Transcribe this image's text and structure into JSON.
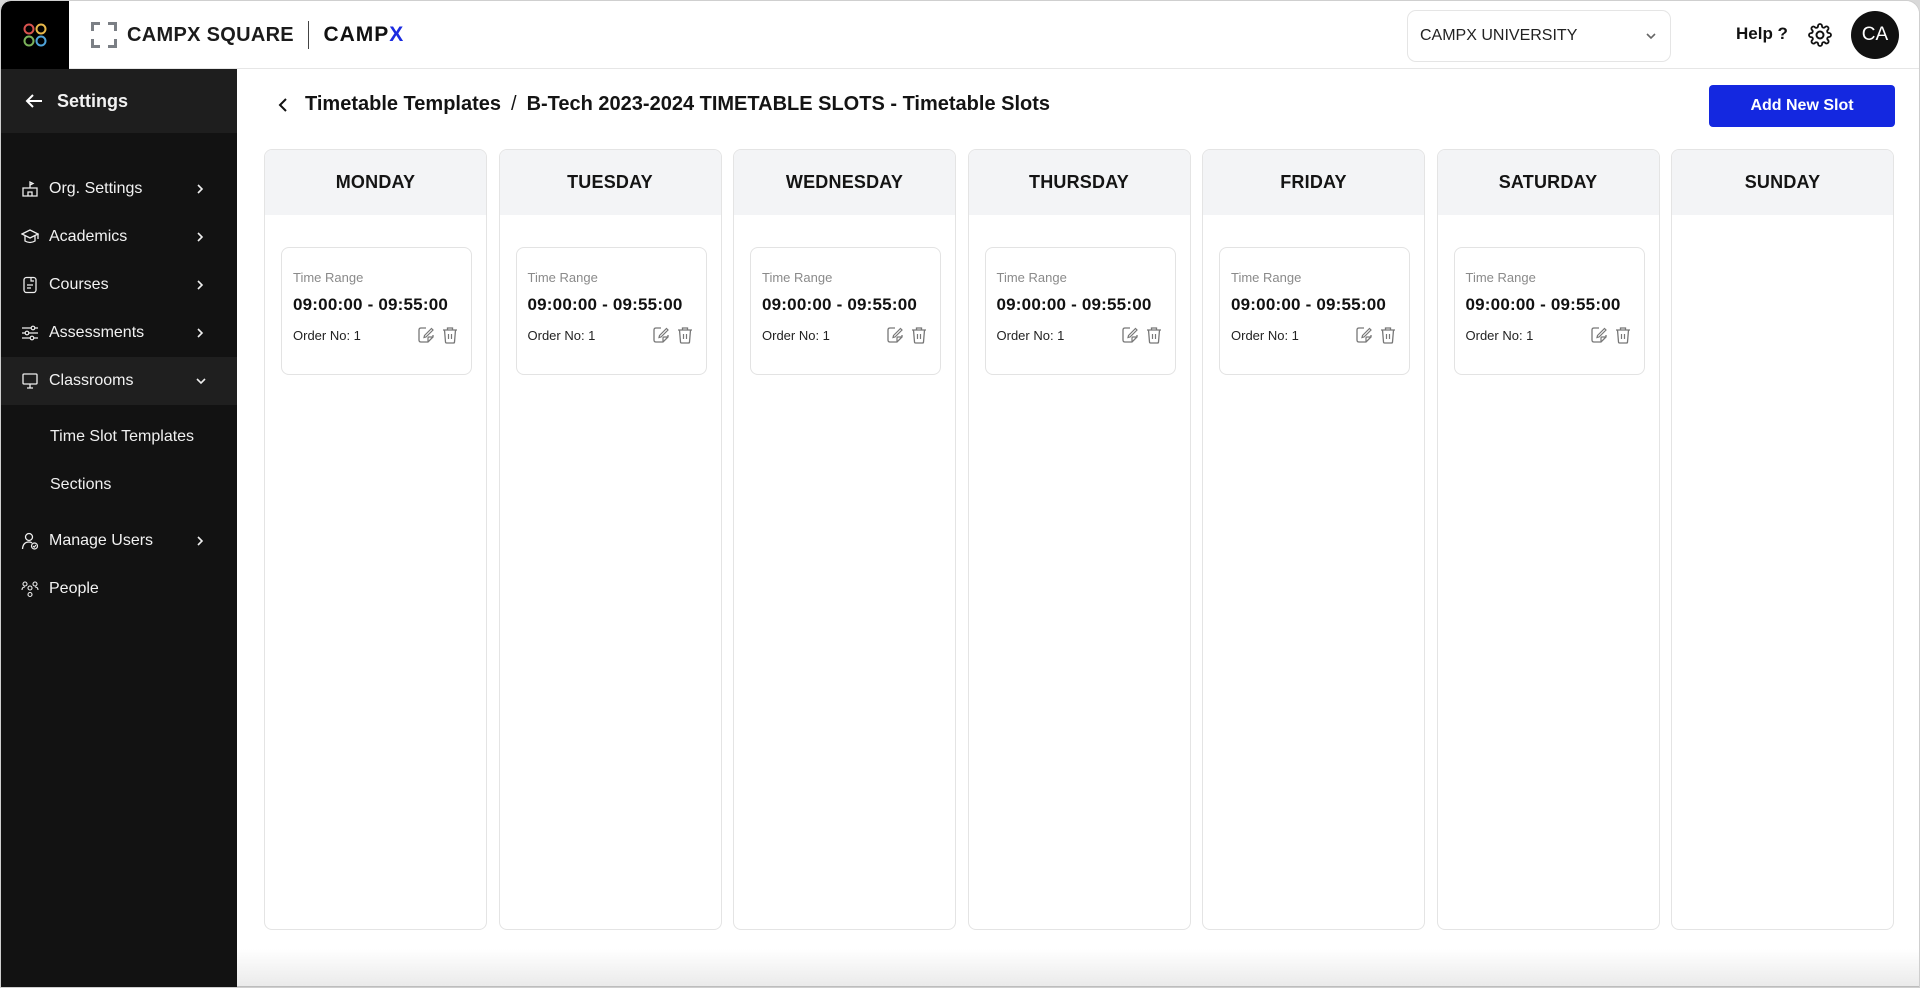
{
  "header": {
    "apps_icon": "apps-grid-icon",
    "brand_name": "CAMPX SQUARE",
    "brand_secondary_prefix": "CAMP",
    "brand_secondary_x": "X",
    "institution_select": {
      "value": "CAMPX UNIVERSITY"
    },
    "help_label": "Help ?",
    "settings_icon": "gear-icon",
    "avatar_initials": "CA"
  },
  "sidebar": {
    "back_title": "Settings",
    "items": [
      {
        "label": "Org. Settings",
        "icon": "building-icon",
        "expanded": false
      },
      {
        "label": "Academics",
        "icon": "graduation-cap-icon",
        "expanded": false
      },
      {
        "label": "Courses",
        "icon": "document-icon",
        "expanded": false
      },
      {
        "label": "Assessments",
        "icon": "sliders-icon",
        "expanded": false
      },
      {
        "label": "Classrooms",
        "icon": "presentation-board-icon",
        "expanded": true,
        "children": [
          {
            "label": "Time Slot Templates"
          },
          {
            "label": "Sections"
          }
        ]
      },
      {
        "label": "Manage Users",
        "icon": "user-check-icon",
        "expanded": false
      },
      {
        "label": "People",
        "icon": "people-icon"
      }
    ]
  },
  "main": {
    "breadcrumb": {
      "parent": "Timetable Templates",
      "separator": "/",
      "current": "B-Tech 2023-2024 TIMETABLE SLOTS - Timetable Slots"
    },
    "add_button_label": "Add New Slot",
    "colors": {
      "accent": "#1428e0",
      "day_header_bg": "#f3f4f6",
      "sidebar_bg": "#121212"
    },
    "days": [
      {
        "name": "MONDAY",
        "slots": [
          {
            "label": "Time Range",
            "time": "09:00:00 - 09:55:00",
            "order": "Order No: 1"
          }
        ]
      },
      {
        "name": "TUESDAY",
        "slots": [
          {
            "label": "Time Range",
            "time": "09:00:00 - 09:55:00",
            "order": "Order No: 1"
          }
        ]
      },
      {
        "name": "WEDNESDAY",
        "slots": [
          {
            "label": "Time Range",
            "time": "09:00:00 - 09:55:00",
            "order": "Order No: 1"
          }
        ]
      },
      {
        "name": "THURSDAY",
        "slots": [
          {
            "label": "Time Range",
            "time": "09:00:00 - 09:55:00",
            "order": "Order No: 1"
          }
        ]
      },
      {
        "name": "FRIDAY",
        "slots": [
          {
            "label": "Time Range",
            "time": "09:00:00 - 09:55:00",
            "order": "Order No: 1"
          }
        ]
      },
      {
        "name": "SATURDAY",
        "slots": [
          {
            "label": "Time Range",
            "time": "09:00:00 - 09:55:00",
            "order": "Order No: 1"
          }
        ]
      },
      {
        "name": "SUNDAY",
        "slots": []
      }
    ]
  }
}
